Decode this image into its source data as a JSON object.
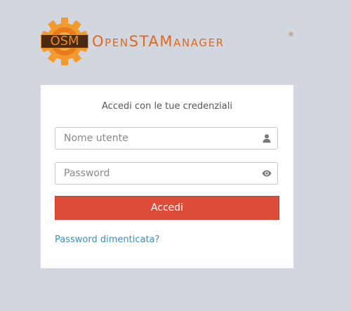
{
  "brand": {
    "abbr": "OSM",
    "name": "OpenSTAManager",
    "registered_mark": "®",
    "primary_color": "#e2681a",
    "gear_color": "#f29a2e"
  },
  "login": {
    "message": "Accedi con le tue credenziali",
    "username_placeholder": "Nome utente",
    "password_placeholder": "Password",
    "username_icon": "user-icon",
    "password_icon": "eye-icon",
    "submit_label": "Accedi",
    "submit_color": "#dd4b39",
    "forgot_label": "Password dimenticata?",
    "link_color": "#3c8dbc"
  }
}
